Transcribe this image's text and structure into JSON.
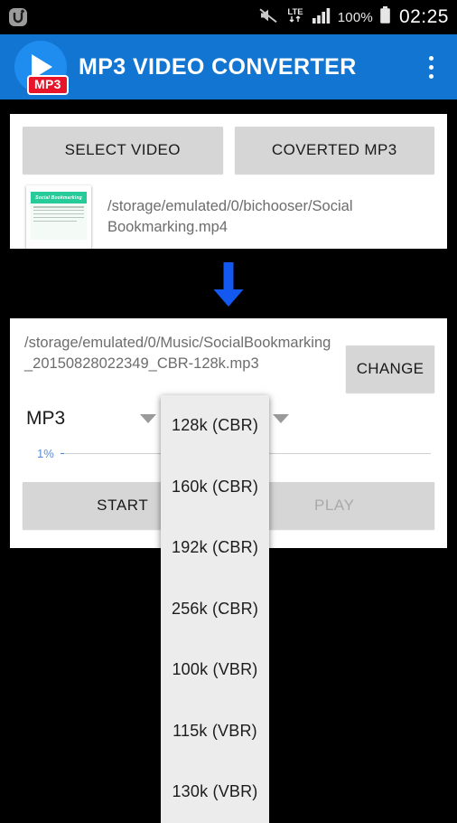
{
  "status_bar": {
    "app_icon": "u-plus-app-icon",
    "mute_icon": "mute-speaker-icon",
    "network_label": "LTE",
    "network_arrows_icon": "data-transfer-arrows-icon",
    "signal_icon": "signal-bars-icon",
    "battery_percent": "100%",
    "battery_icon": "battery-full-icon",
    "clock": "02:25"
  },
  "app_bar": {
    "title": "MP3 VIDEO CONVERTER",
    "logo_badge": "MP3",
    "logo_icon": "play-circle-icon",
    "overflow_icon": "overflow-menu-icon",
    "background_color": "#1275d1"
  },
  "source_card": {
    "select_video_label": "SELECT VIDEO",
    "converted_mp3_label": "COVERTED MP3",
    "thumbnail": {
      "icon": "video-thumbnail",
      "banner_text": "Social Bookmarking"
    },
    "file_path": "/storage/emulated/0/bichooser/Social Bookmarking.mp4"
  },
  "arrow": {
    "icon": "arrow-down-icon",
    "color": "#1358ef"
  },
  "output_card": {
    "output_path": "/storage/emulated/0/Music/SocialBookmarking_20150828022349_CBR-128k.mp3",
    "change_label": "CHANGE",
    "format_value": "MP3",
    "bitrate_value": "128k (CBR)",
    "caret_icon": "chevron-down-icon",
    "progress_percent_label": "1%",
    "progress_percent": 1,
    "progress_color": "#4a86d8",
    "start_label": "START",
    "play_label": "PLAY",
    "play_enabled": false
  },
  "bitrate_dropdown": {
    "open": true,
    "options": [
      "128k (CBR)",
      "160k (CBR)",
      "192k (CBR)",
      "256k (CBR)",
      "100k (VBR)",
      "115k (VBR)",
      "130k (VBR)"
    ]
  }
}
